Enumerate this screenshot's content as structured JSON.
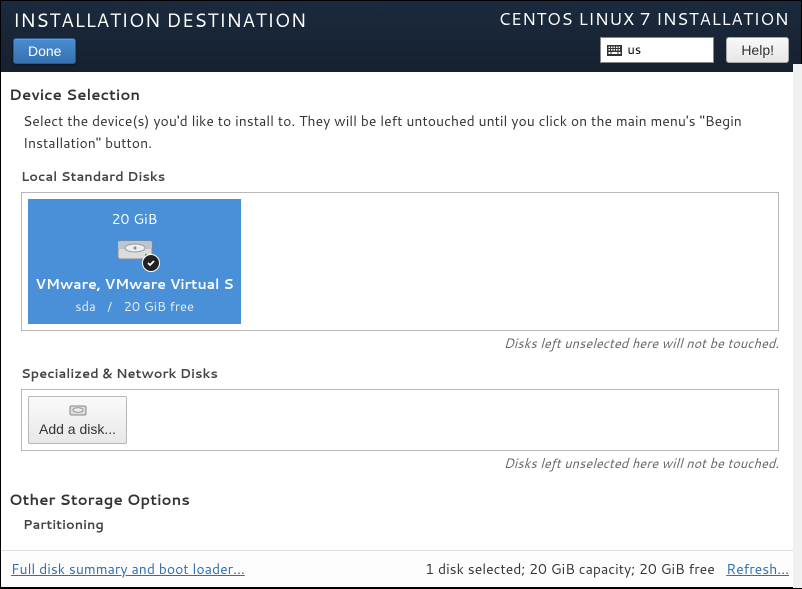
{
  "header": {
    "title": "INSTALLATION DESTINATION",
    "done_label": "Done",
    "brand": "CENTOS LINUX 7 INSTALLATION",
    "lang_code": "us",
    "help_label": "Help!"
  },
  "device_selection": {
    "heading": "Device Selection",
    "description": "Select the device(s) you'd like to install to.  They will be left untouched until you click on the main menu's \"Begin Installation\" button.",
    "local_disks_label": "Local Standard Disks",
    "disks": [
      {
        "size": "20 GiB",
        "name": "VMware, VMware Virtual S",
        "dev": "sda",
        "free": "20 GiB free",
        "selected": true
      }
    ],
    "unselected_note": "Disks left unselected here will not be touched.",
    "specialized_label": "Specialized & Network Disks",
    "add_disk_label": "Add a disk..."
  },
  "other_storage": {
    "heading": "Other Storage Options",
    "partitioning_label": "Partitioning"
  },
  "footer": {
    "summary_link": "Full disk summary and boot loader...",
    "status": "1 disk selected; 20 GiB capacity; 20 GiB free",
    "refresh_link": "Refresh..."
  }
}
